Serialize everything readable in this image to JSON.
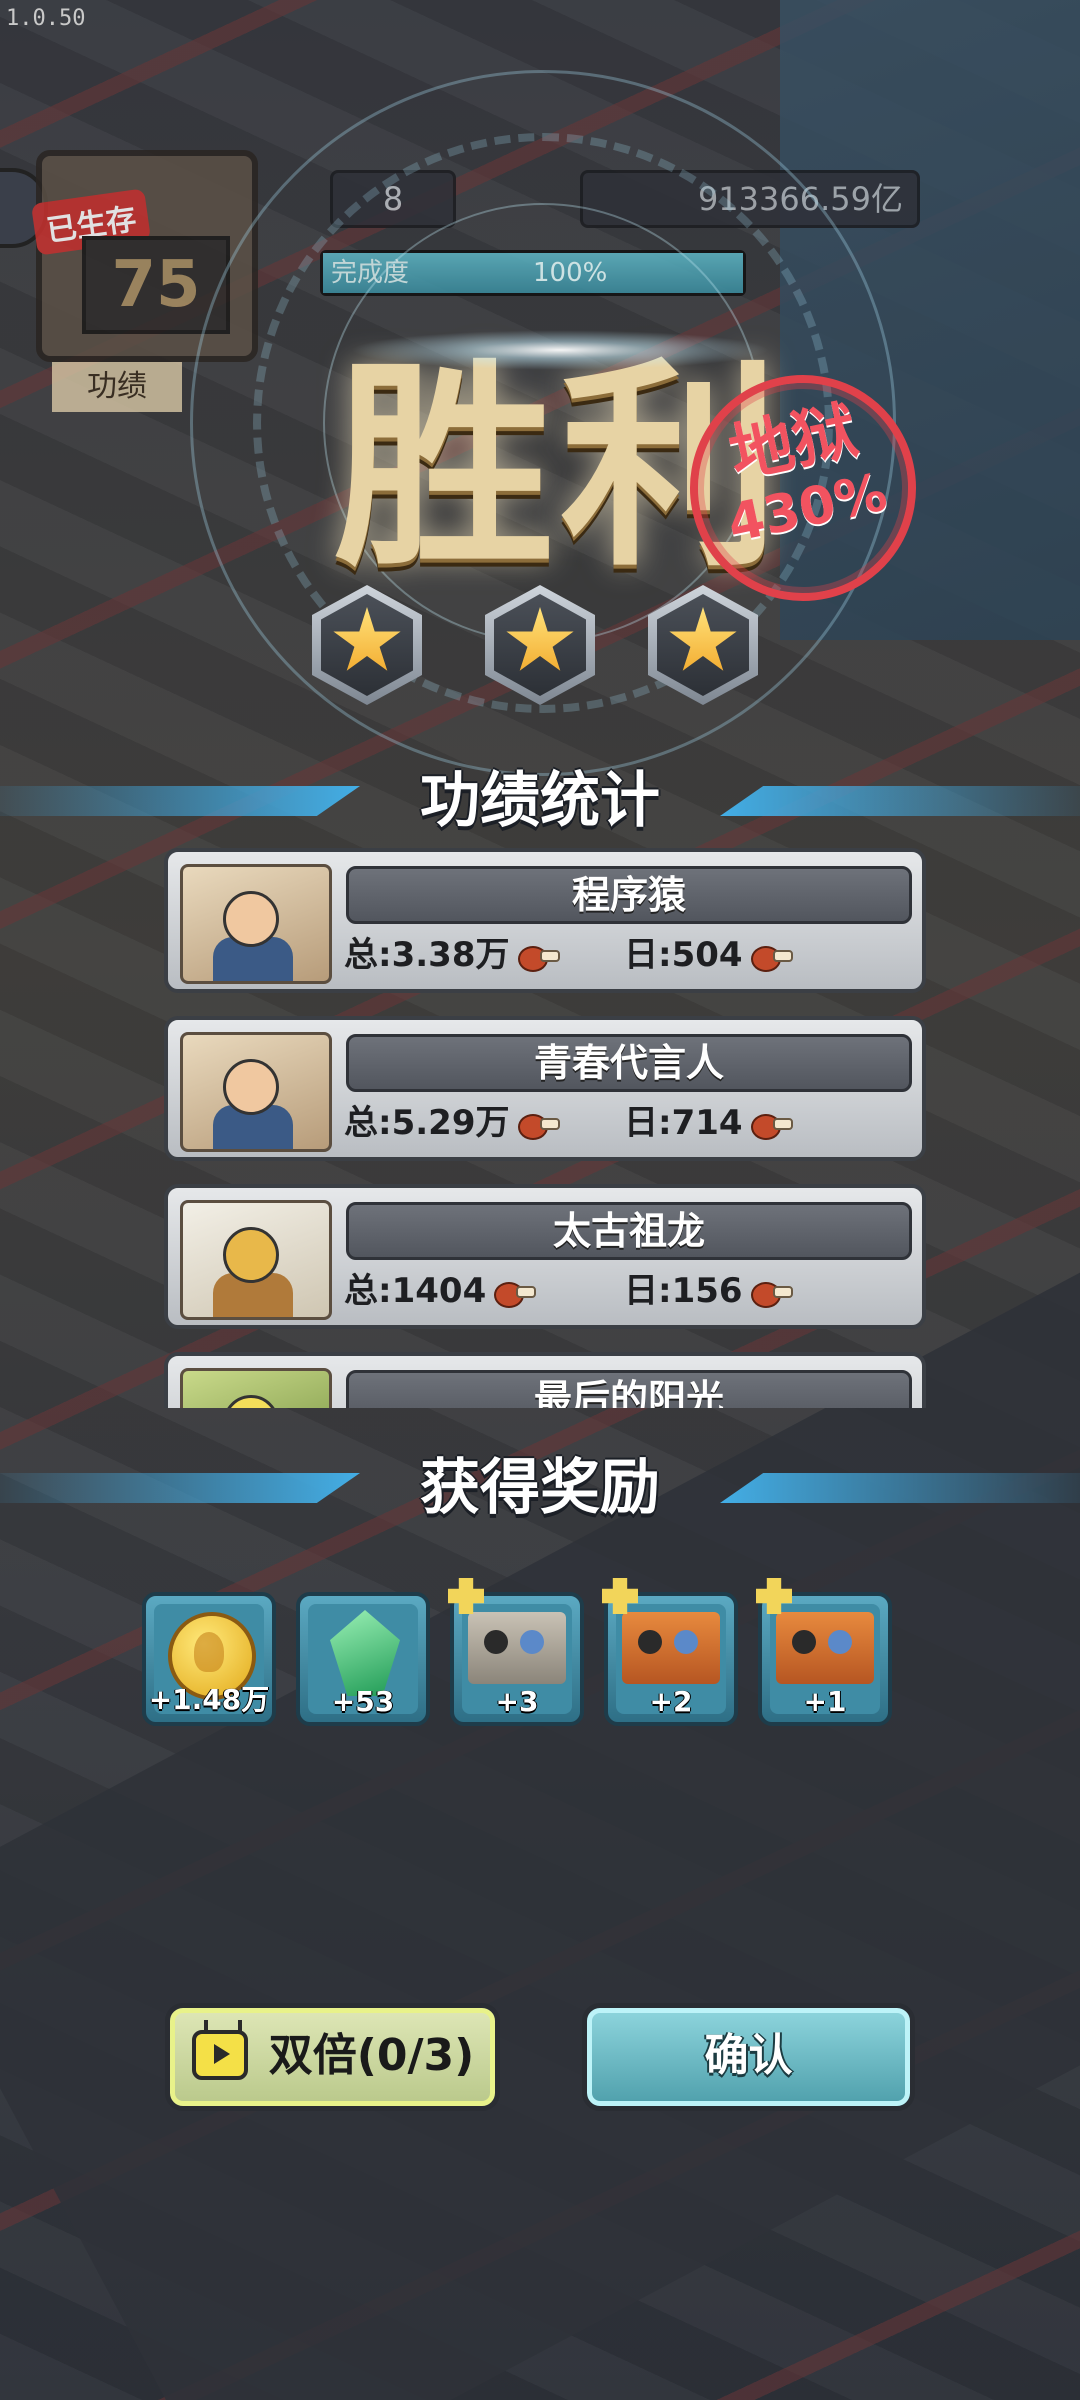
{
  "version": "1.0.50",
  "hud": {
    "survived_tag": "已生存",
    "days": "75",
    "merit_label": "功绩",
    "level": "8",
    "coins": "913366.59亿",
    "progress_label": "完成度",
    "progress_value": "100%",
    "progress_fraction": 1.0
  },
  "victory": {
    "title": "胜利",
    "difficulty": "地狱",
    "difficulty_pct": "430%",
    "stars_earned": 3
  },
  "stats": {
    "title": "功绩统计",
    "total_prefix": "总:",
    "daily_prefix": "日:",
    "items": [
      {
        "name": "程序猿",
        "total": "3.38万",
        "daily": "504"
      },
      {
        "name": "青春代言人",
        "total": "5.29万",
        "daily": "714"
      },
      {
        "name": "太古祖龙",
        "total": "1404",
        "daily": "156"
      },
      {
        "name": "最后的阳光",
        "total": "",
        "daily": ""
      }
    ]
  },
  "rewards": {
    "title": "获得奖励",
    "items": [
      {
        "kind": "coin",
        "amount": "+1.48万"
      },
      {
        "kind": "gem",
        "amount": "+53"
      },
      {
        "kind": "character-card",
        "amount": "+3"
      },
      {
        "kind": "character-card",
        "amount": "+2"
      },
      {
        "kind": "character-card",
        "amount": "+1"
      }
    ]
  },
  "buttons": {
    "double": "双倍(0/3)",
    "confirm": "确认"
  },
  "colors": {
    "accent_blue": "#43aee6",
    "stamp_red": "#e8394a",
    "star_gold": "#f2a92c"
  }
}
